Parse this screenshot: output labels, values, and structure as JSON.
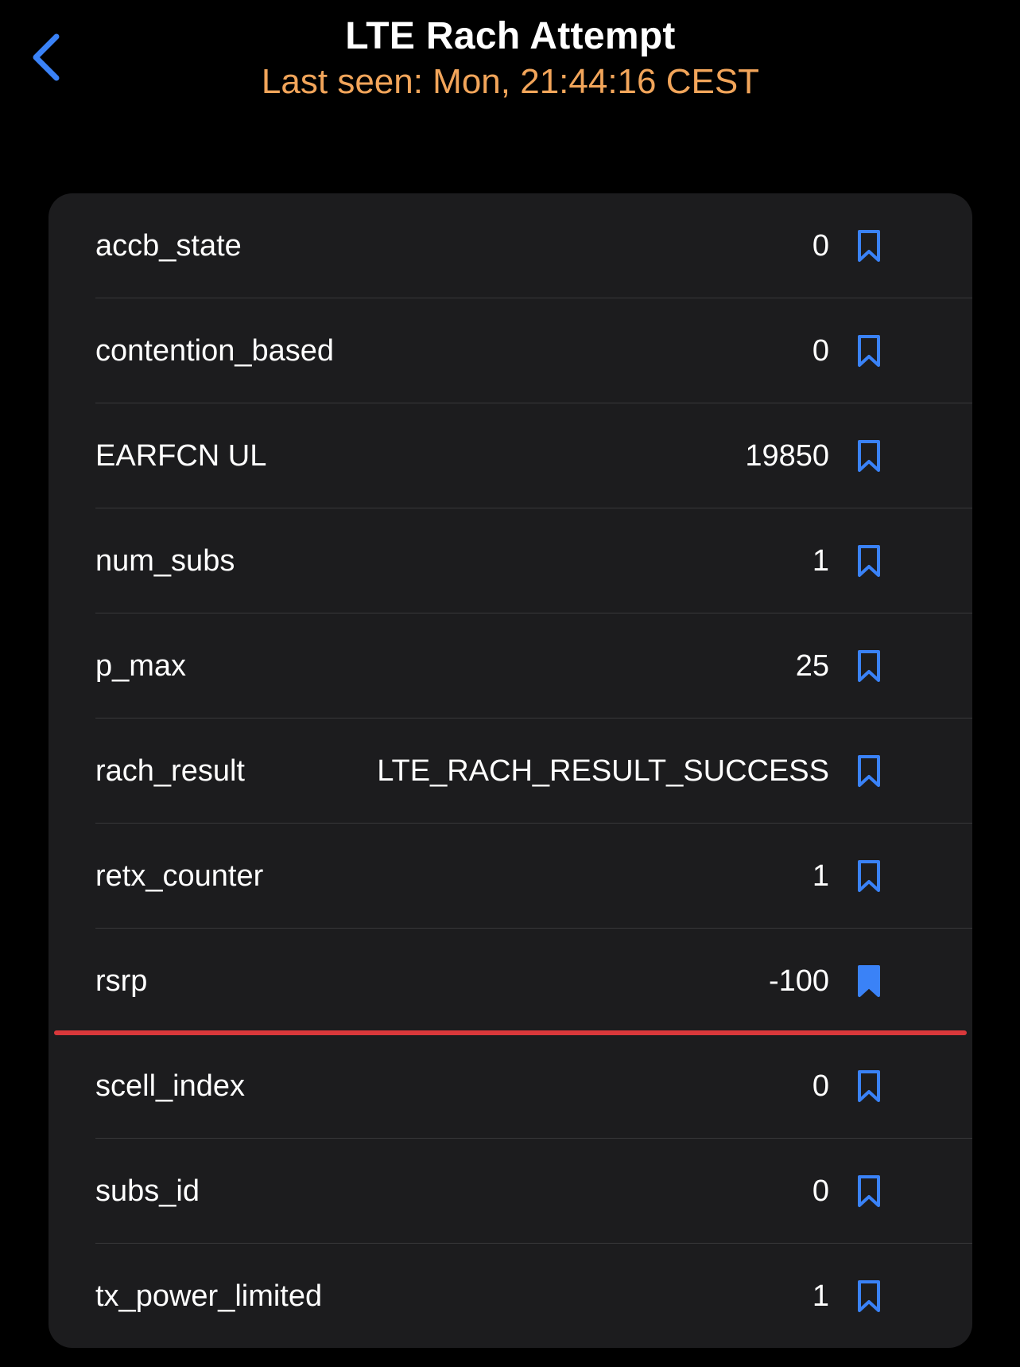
{
  "header": {
    "title": "LTE Rach Attempt",
    "subtitle": "Last seen: Mon, 21:44:16 CEST",
    "back_icon": "chevron-left-icon"
  },
  "colors": {
    "background": "#000000",
    "card": "#1c1c1e",
    "accent_blue": "#3a82f7",
    "subtitle_orange": "#f2a55a",
    "highlight_red": "#d9383b"
  },
  "rows": [
    {
      "label": "accb_state",
      "value": "0",
      "bookmarked": false
    },
    {
      "label": "contention_based",
      "value": "0",
      "bookmarked": false
    },
    {
      "label": "EARFCN UL",
      "value": "19850",
      "bookmarked": false
    },
    {
      "label": "num_subs",
      "value": "1",
      "bookmarked": false
    },
    {
      "label": "p_max",
      "value": "25",
      "bookmarked": false
    },
    {
      "label": "rach_result",
      "value": "LTE_RACH_RESULT_SUCCESS",
      "bookmarked": false
    },
    {
      "label": "retx_counter",
      "value": "1",
      "bookmarked": false
    },
    {
      "label": "rsrp",
      "value": "-100",
      "bookmarked": true,
      "highlighted": true
    },
    {
      "label": "scell_index",
      "value": "0",
      "bookmarked": false
    },
    {
      "label": "subs_id",
      "value": "0",
      "bookmarked": false
    },
    {
      "label": "tx_power_limited",
      "value": "1",
      "bookmarked": false
    }
  ]
}
